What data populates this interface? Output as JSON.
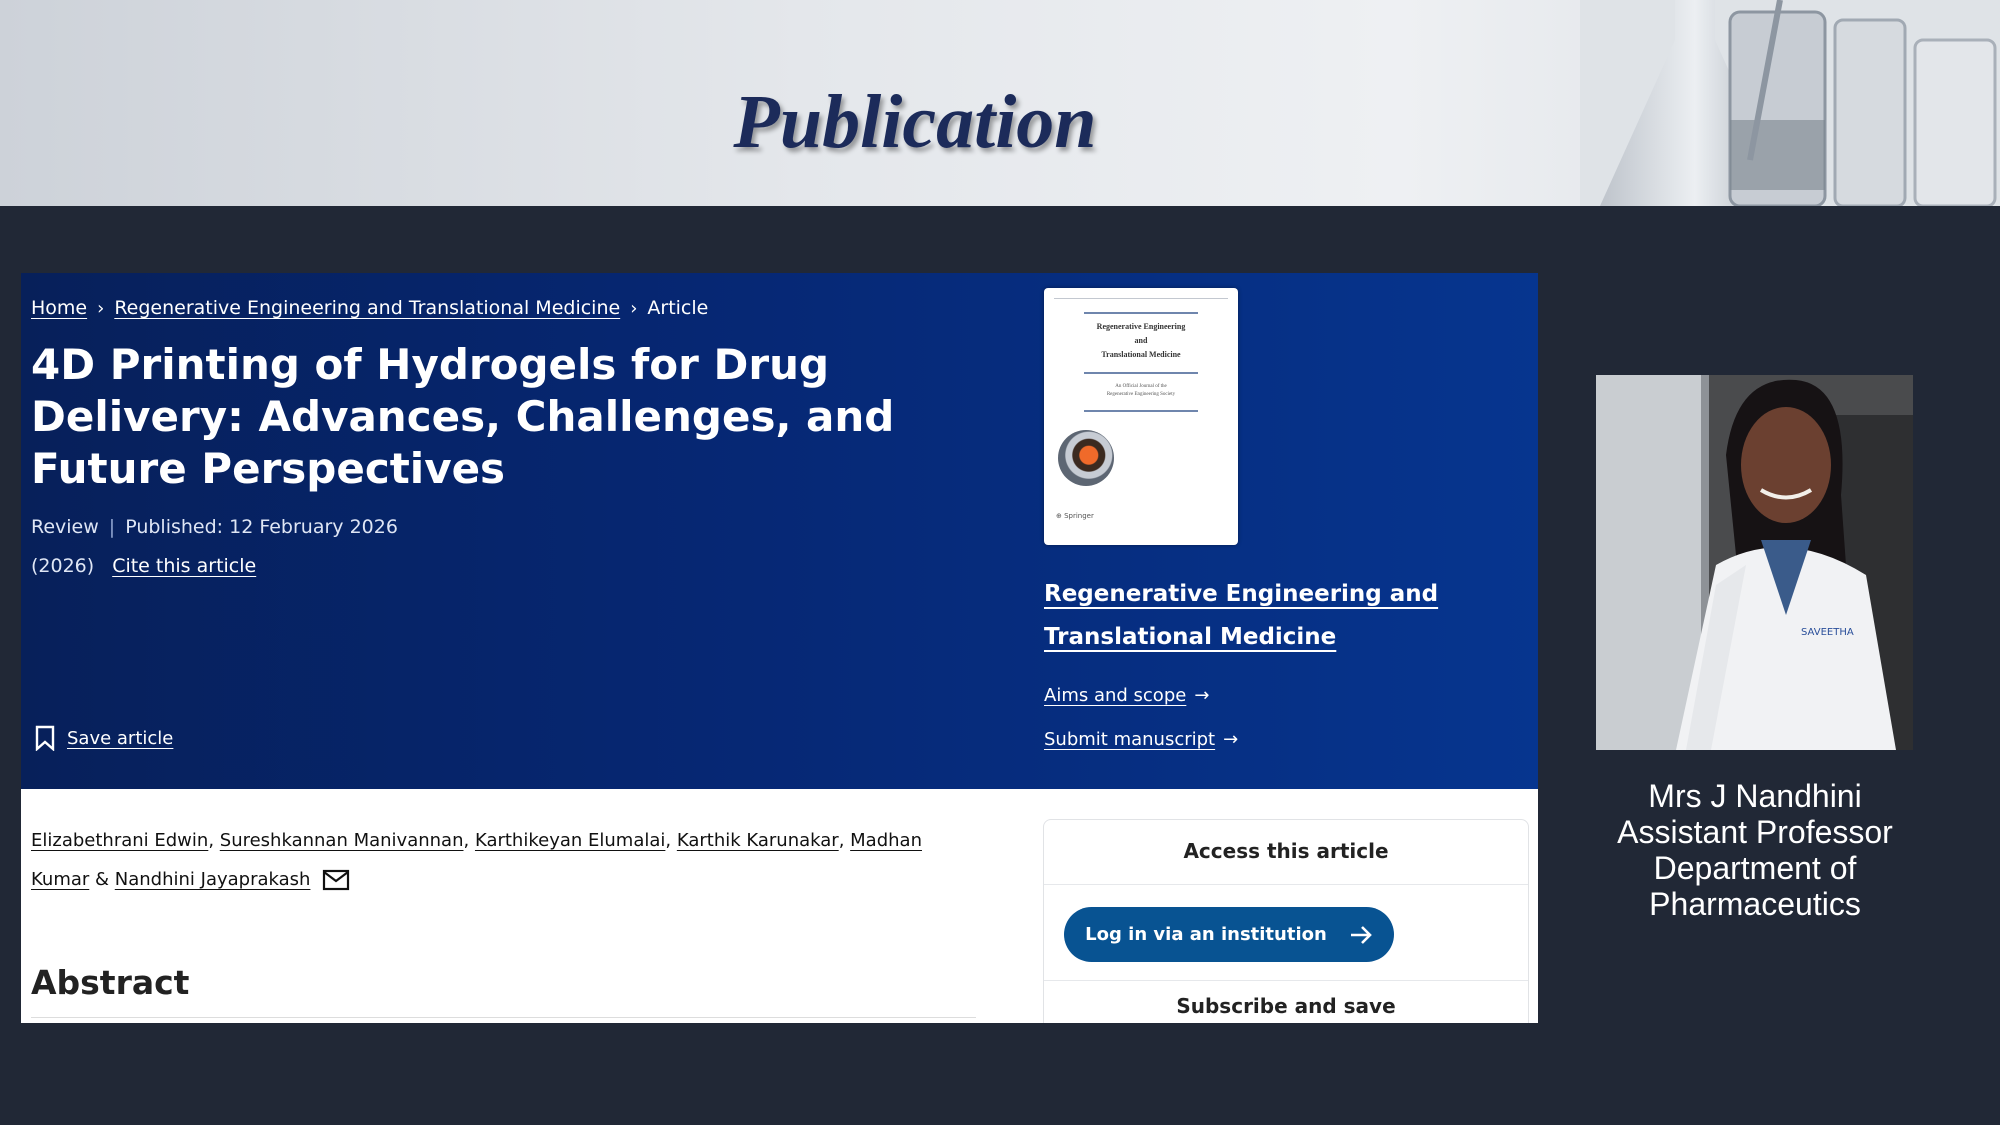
{
  "slide": {
    "title": "Publication"
  },
  "article_page": {
    "breadcrumb": [
      "Home",
      "Regenerative Engineering and Translational Medicine",
      "Article"
    ],
    "title": "4D Printing of Hydrogels for Drug Delivery: Advances, Challenges, and Future Perspectives",
    "type": "Review",
    "published": "Published: 12 February 2026",
    "year": "(2026)",
    "cite_link": "Cite this article",
    "save_label": "Save article",
    "journal_name": "Regenerative Engineering and Translational Medicine",
    "links": {
      "aims": "Aims and scope",
      "submit": "Submit manuscript"
    },
    "authors": [
      "Elizabethrani Edwin",
      "Sureshkannan Manivannan",
      "Karthikeyan Elumalai",
      "Karthik Karunakar",
      "Madhan Kumar",
      "Nandhini Jayaprakash"
    ],
    "abstract_heading": "Abstract",
    "access": {
      "heading": "Access this article",
      "login_button": "Log in via an institution",
      "subscribe": "Subscribe and save"
    }
  },
  "profile": {
    "name": "Mrs J Nandhini",
    "role": "Assistant Professor",
    "department_line1": "Department of",
    "department_line2": "Pharmaceutics"
  },
  "colors": {
    "banner": "#062773",
    "background": "#212836",
    "login_button": "#085392",
    "title": "#1c2b5a"
  }
}
